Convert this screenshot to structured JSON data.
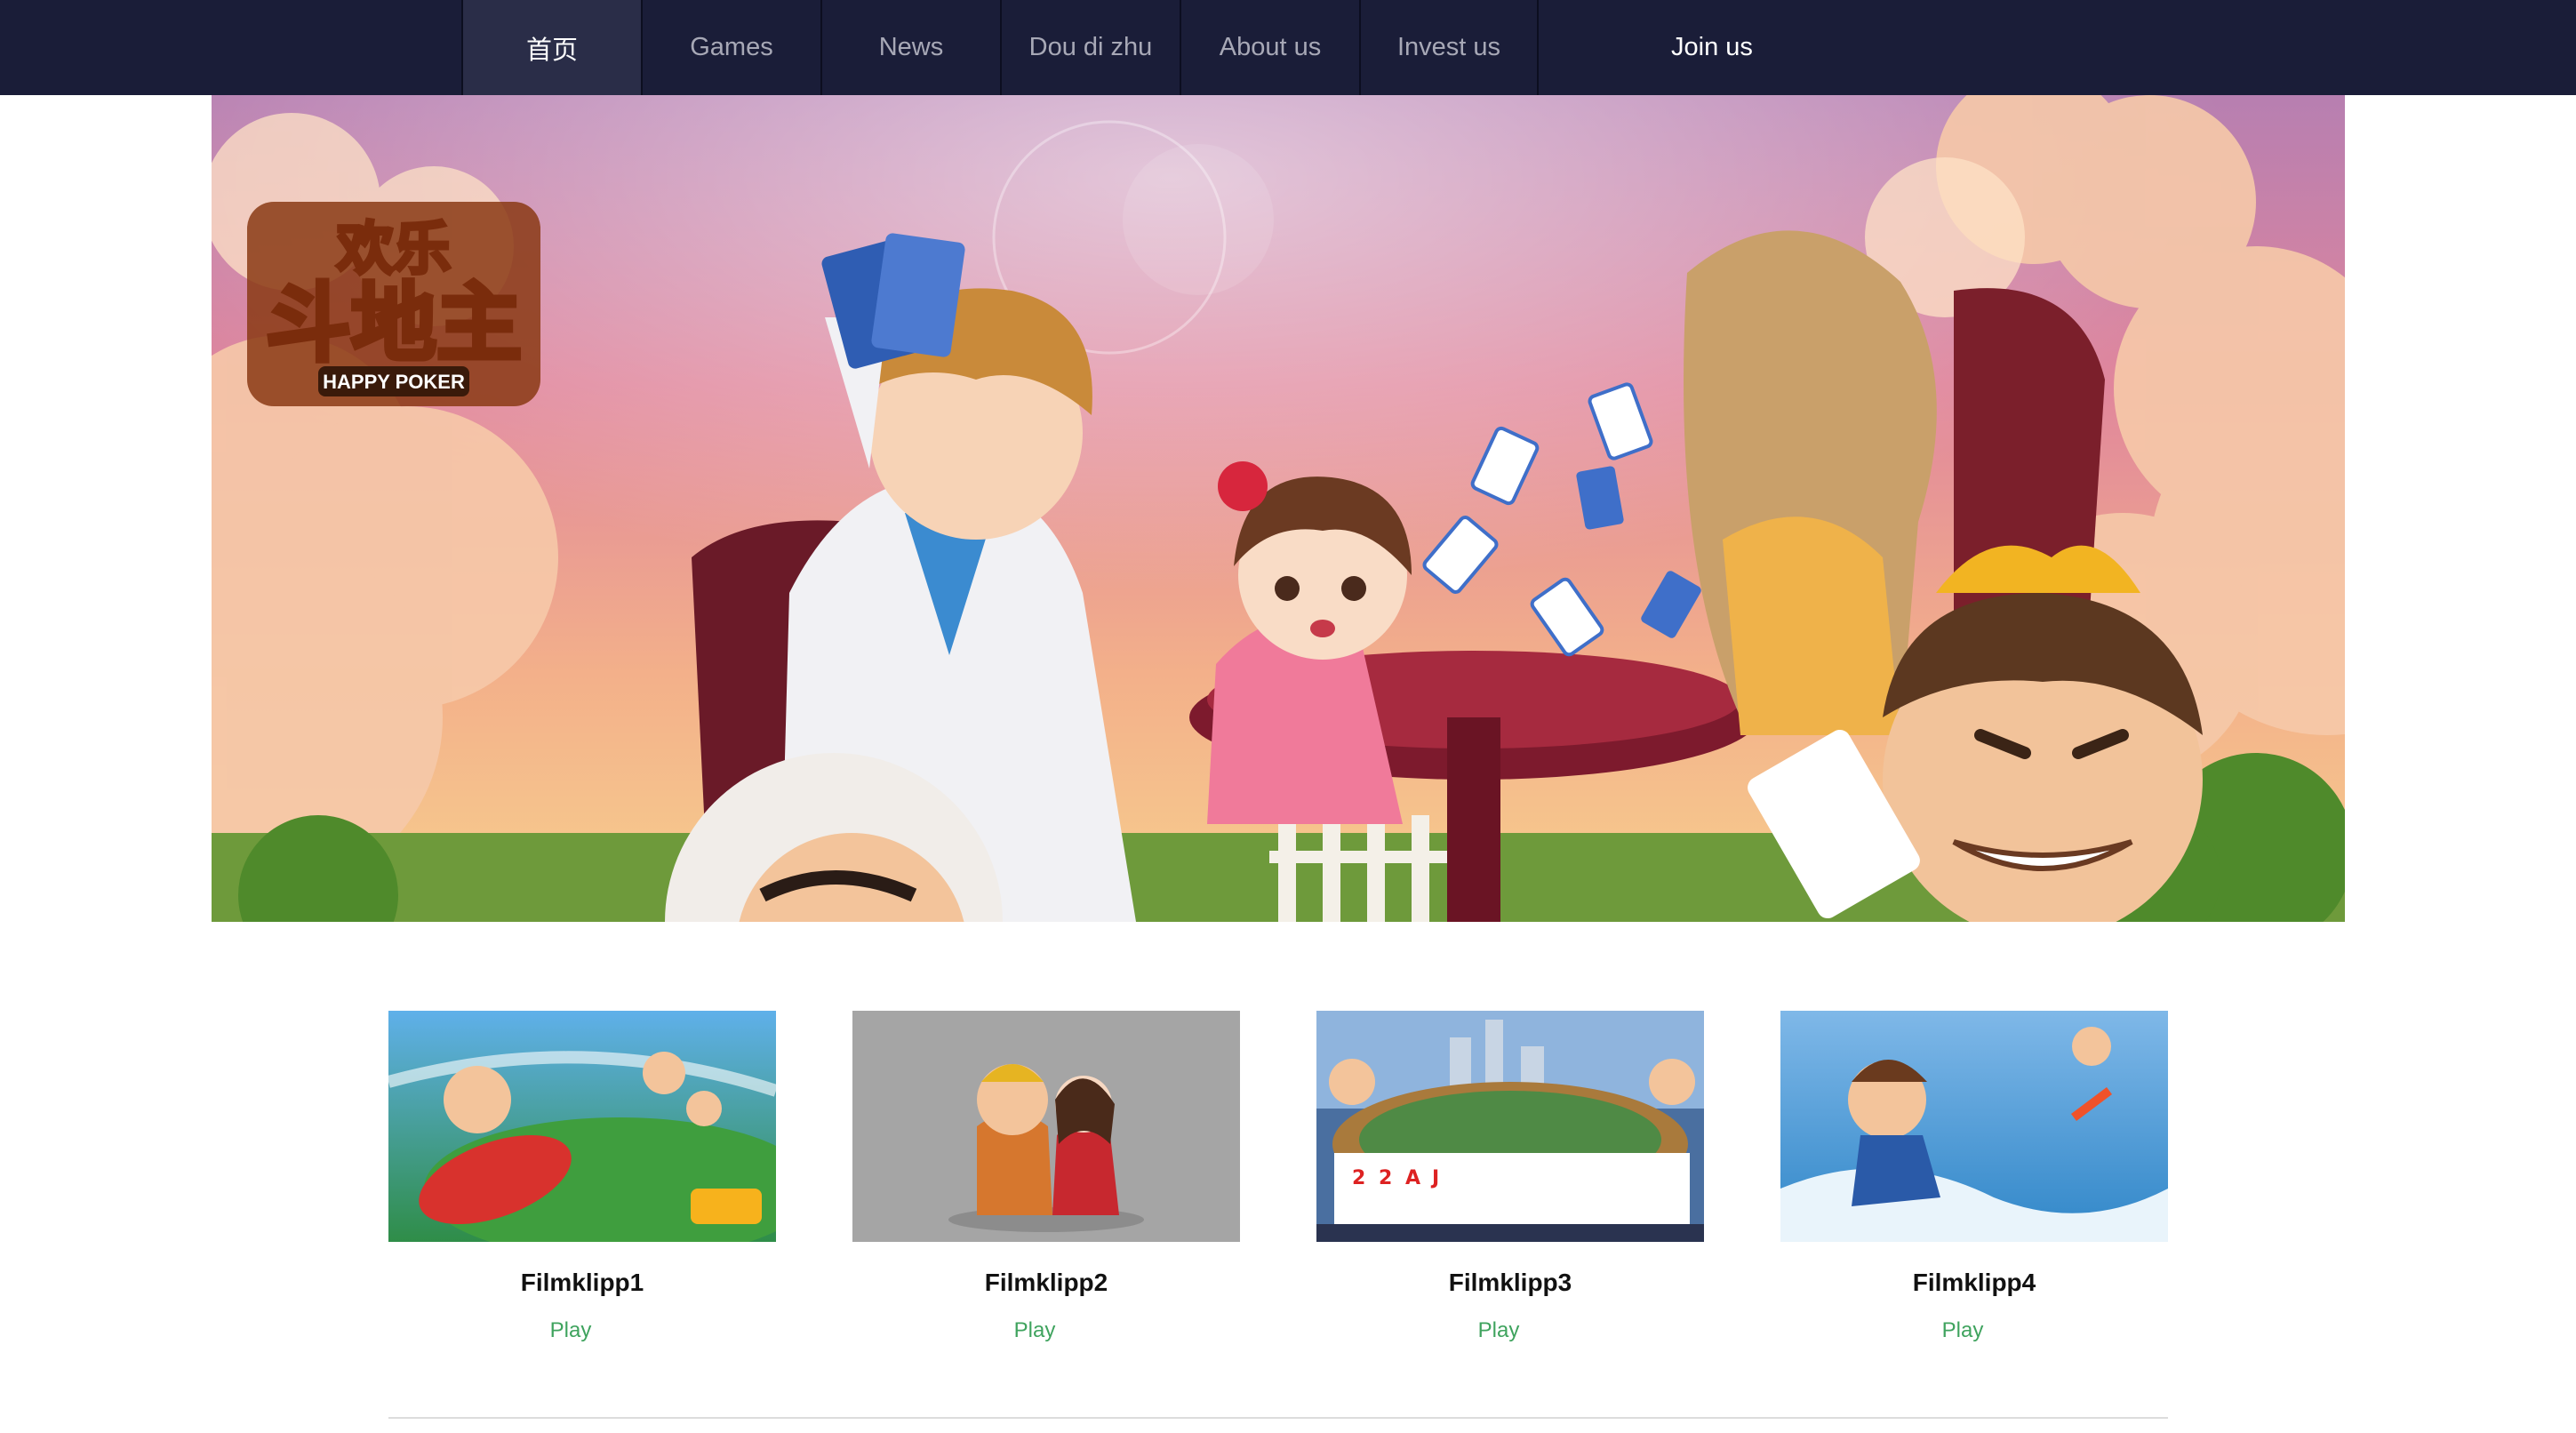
{
  "nav": {
    "items": [
      {
        "label": "首页",
        "active": true
      },
      {
        "label": "Games",
        "active": false
      },
      {
        "label": "News",
        "active": false
      },
      {
        "label": "Dou di zhu",
        "active": false
      },
      {
        "label": "About us",
        "active": false
      },
      {
        "label": "Invest us",
        "active": false
      }
    ],
    "join_label": "Join us"
  },
  "hero": {
    "logo_top": "欢乐",
    "logo_main": "斗地主",
    "logo_sub": "HAPPY POKER"
  },
  "cards": [
    {
      "title": "Filmklipp1",
      "action": "Play"
    },
    {
      "title": "Filmklipp2",
      "action": "Play"
    },
    {
      "title": "Filmklipp3",
      "action": "Play"
    },
    {
      "title": "Filmklipp4",
      "action": "Play"
    }
  ],
  "colors": {
    "nav_bg": "#1a1d38",
    "nav_active_bg": "#2a2d48",
    "play_link": "#3fa35e",
    "divider": "#dcdcdc"
  }
}
